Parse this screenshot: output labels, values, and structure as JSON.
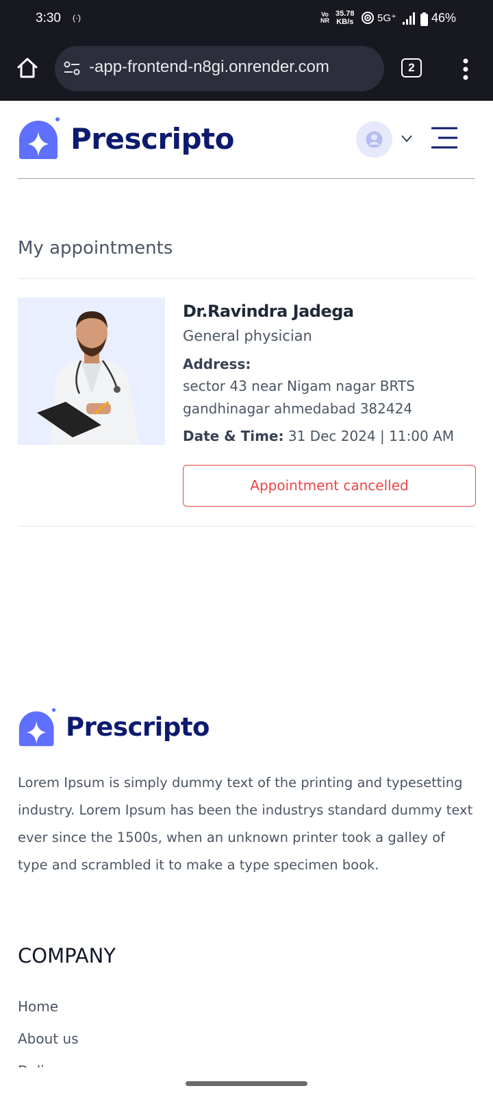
{
  "status_bar": {
    "time": "3:30",
    "volte_top": "Vo",
    "volte_bottom": "NR",
    "speed_value": "35.78",
    "speed_unit": "KB/s",
    "network": "5G⁺",
    "battery": "46%"
  },
  "browser": {
    "url": "-app-frontend-n8gi.onrender.com",
    "tab_count": "2"
  },
  "header": {
    "logo_text": "Prescripto"
  },
  "main": {
    "title": "My appointments",
    "appointment": {
      "doctor_name": "Dr.Ravindra Jadega",
      "speciality": "General physician",
      "address_label": "Address:",
      "address_line1": "sector 43 near Nigam nagar BRTS",
      "address_line2": "gandhinagar ahmedabad 382424",
      "datetime_label": "Date & Time:",
      "datetime_value": " 31 Dec 2024 | 11:00 AM",
      "status": "Appointment cancelled"
    }
  },
  "footer": {
    "logo_text": "Prescripto",
    "description": "Lorem Ipsum is simply dummy text of the printing and typesetting industry. Lorem Ipsum has been the industrys standard dummy text ever since the 1500s, when an unknown printer took a galley of type and scrambled it to make a type specimen book.",
    "company_title": "COMPANY",
    "links": [
      "Home",
      "About us",
      "Delivery"
    ]
  },
  "colors": {
    "brand_blue": "#5f6fff",
    "logo_text": "#0d1a6e",
    "cancel_red": "#ef4444",
    "photo_bg": "#eaefff"
  },
  "icons": [
    "home-icon",
    "site-settings-icon",
    "tab-switcher-icon",
    "overflow-menu-icon",
    "user-avatar-icon",
    "chevron-down-icon",
    "hamburger-menu-icon",
    "prescripto-logo-icon"
  ]
}
